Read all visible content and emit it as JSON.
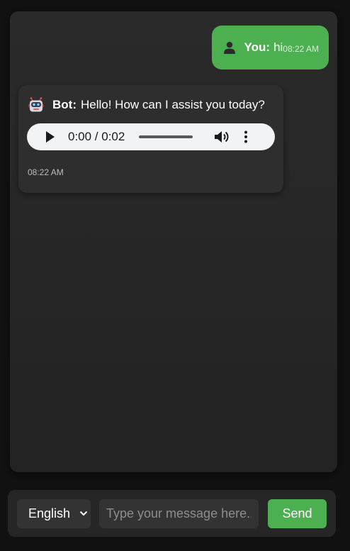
{
  "chat": {
    "user_message": {
      "sender_label": "You:",
      "text": "hi",
      "timestamp": "08:22 AM",
      "icon": "user-silhouette-icon",
      "bubble_color": "#4caf50"
    },
    "bot_message": {
      "sender_label": "Bot:",
      "text": "Hello! How can I assist you today?",
      "timestamp": "08:22 AM",
      "icon": "robot-icon",
      "audio": {
        "time_display": "0:00 / 0:02",
        "current": "0:00",
        "duration": "0:02",
        "progress": 0
      }
    }
  },
  "composer": {
    "language": {
      "selected": "English"
    },
    "input": {
      "value": "",
      "placeholder": "Type your message here..."
    },
    "send_label": "Send",
    "accent_color": "#4caf50"
  }
}
